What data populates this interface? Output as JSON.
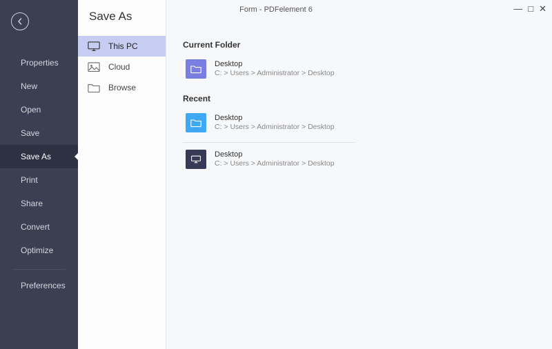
{
  "window": {
    "title": "Form - PDFelement 6"
  },
  "sidebar": {
    "items": [
      {
        "label": "Properties"
      },
      {
        "label": "New"
      },
      {
        "label": "Open"
      },
      {
        "label": "Save"
      },
      {
        "label": "Save As",
        "selected": true
      },
      {
        "label": "Print"
      },
      {
        "label": "Share"
      },
      {
        "label": "Convert"
      },
      {
        "label": "Optimize"
      }
    ],
    "footer": {
      "label": "Preferences"
    }
  },
  "page": {
    "title": "Save As"
  },
  "locations": {
    "items": [
      {
        "icon": "monitor-icon",
        "label": "This PC",
        "selected": true
      },
      {
        "icon": "picture-icon",
        "label": "Cloud"
      },
      {
        "icon": "folder-icon",
        "label": "Browse"
      }
    ]
  },
  "sections": {
    "current": {
      "title": "Current Folder",
      "entry": {
        "name": "Desktop",
        "path": "C: > Users > Administrator > Desktop"
      }
    },
    "recent": {
      "title": "Recent",
      "entries": [
        {
          "name": "Desktop",
          "path": "C: > Users > Administrator > Desktop",
          "style": "blue-folder"
        },
        {
          "name": "Desktop",
          "path": "C: > Users > Administrator > Desktop",
          "style": "dark-monitor"
        }
      ]
    }
  }
}
